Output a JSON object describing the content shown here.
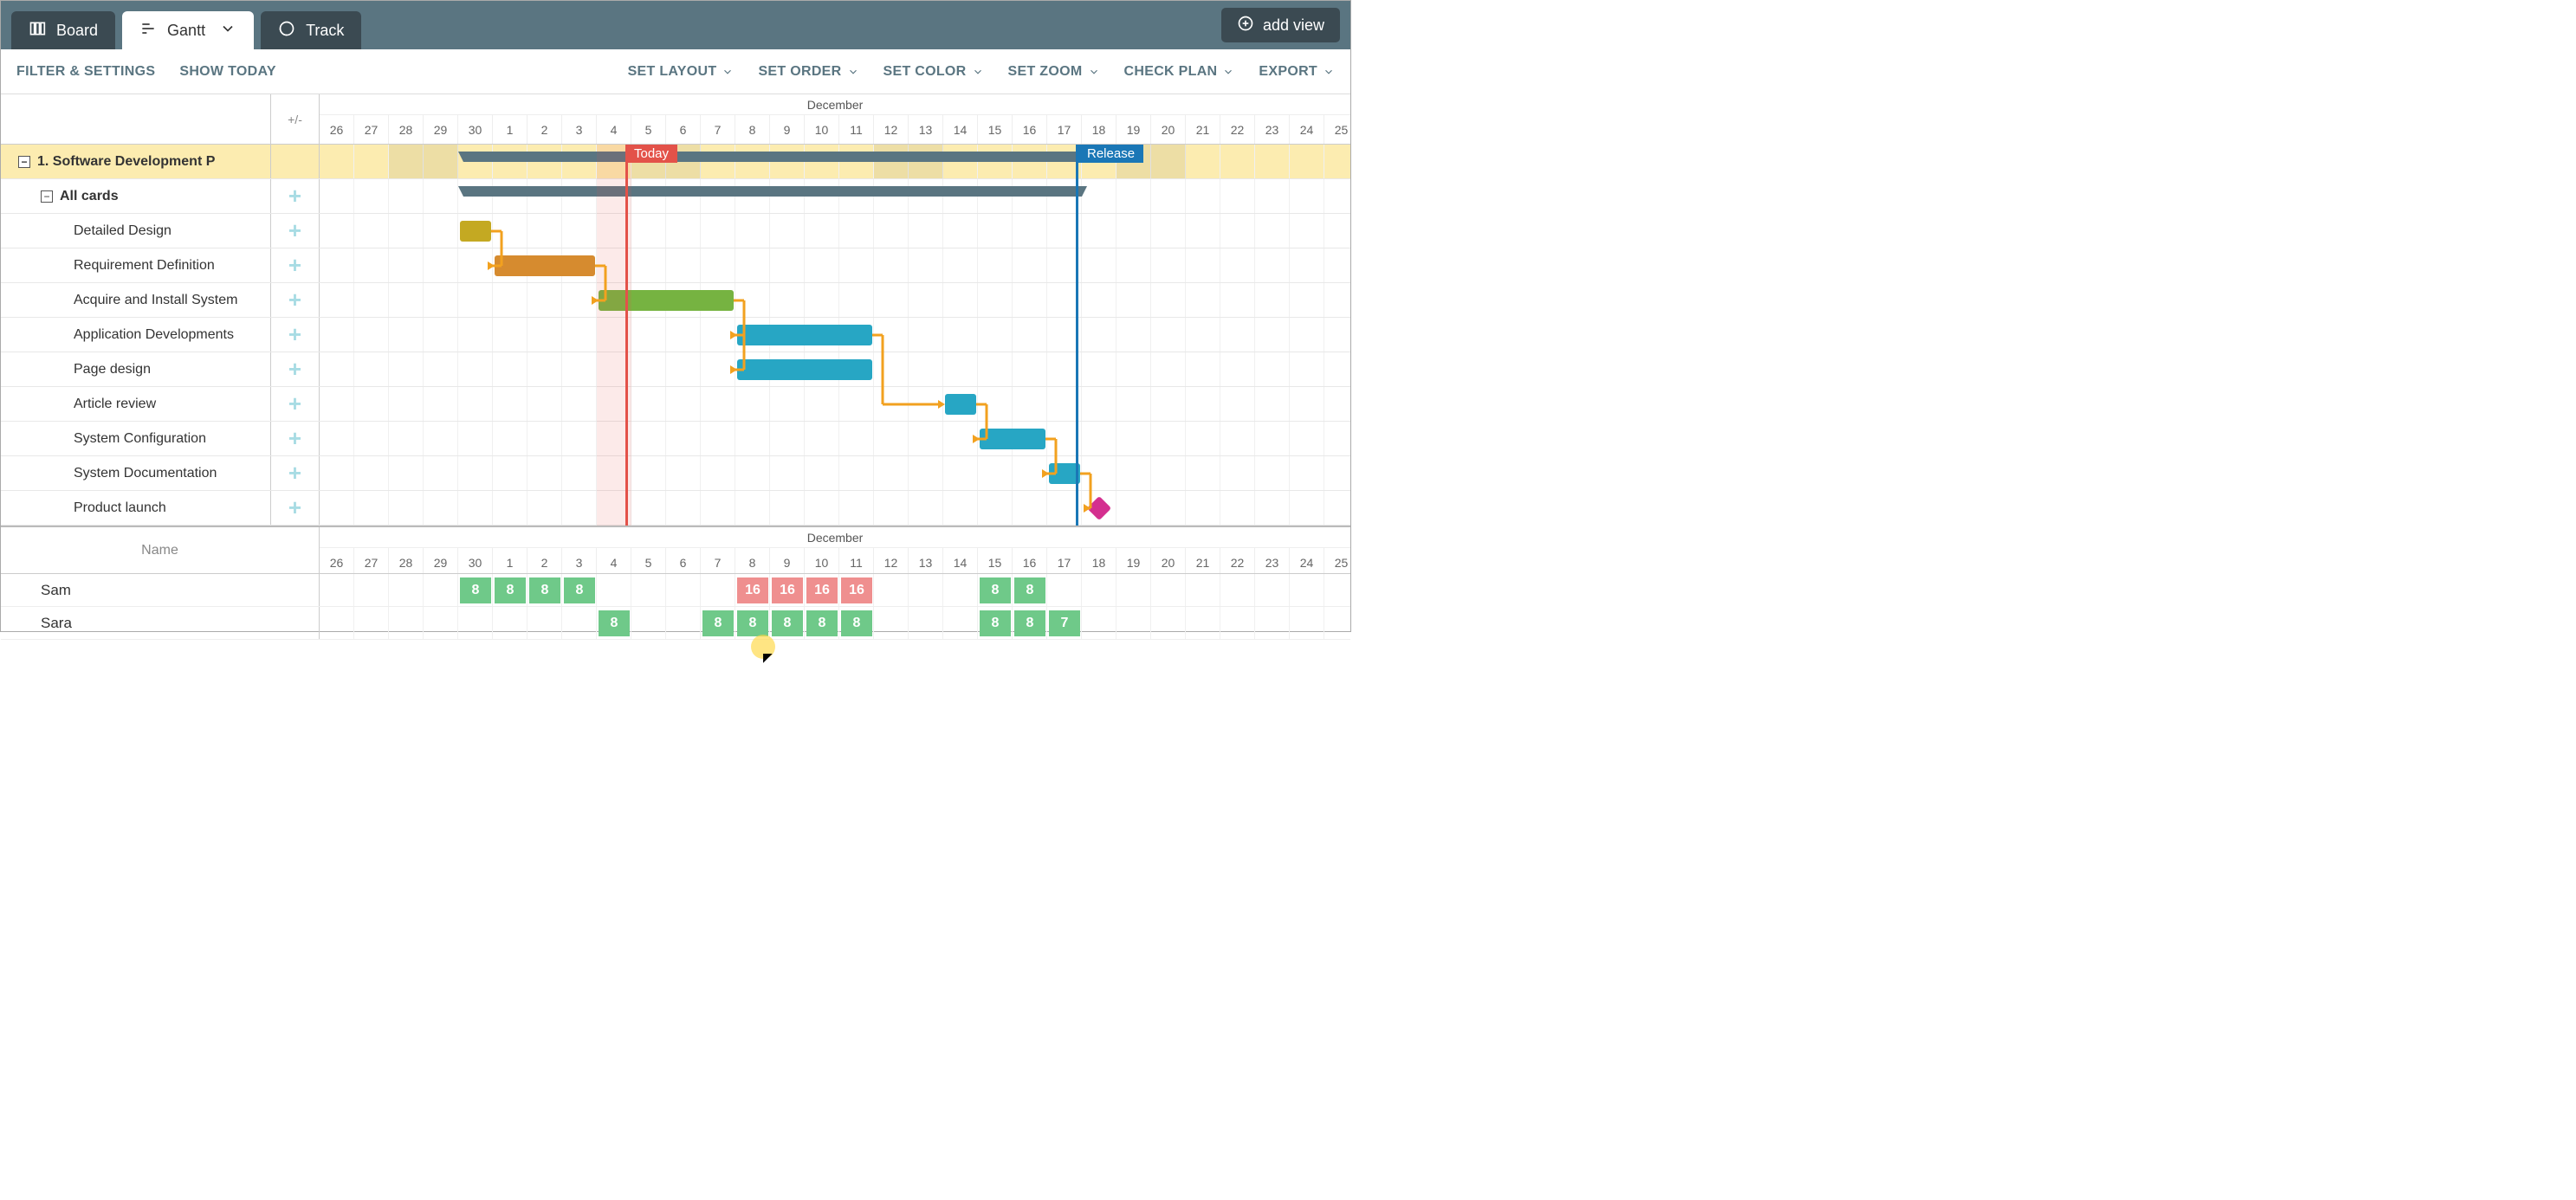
{
  "tabs": {
    "board": "Board",
    "gantt": "Gantt",
    "track": "Track"
  },
  "addView": "add view",
  "toolbar": {
    "filter": "FILTER & SETTINGS",
    "showToday": "SHOW TODAY",
    "setLayout": "SET LAYOUT",
    "setOrder": "SET ORDER",
    "setColor": "SET COLOR",
    "setZoom": "SET ZOOM",
    "checkPlan": "CHECK PLAN",
    "export": "EXPORT"
  },
  "plusMinus": "+/-",
  "month": "December",
  "days": [
    "26",
    "27",
    "28",
    "29",
    "30",
    "1",
    "2",
    "3",
    "4",
    "5",
    "6",
    "7",
    "8",
    "9",
    "10",
    "11",
    "12",
    "13",
    "14",
    "15",
    "16",
    "17",
    "18",
    "19",
    "20",
    "21",
    "22",
    "23",
    "24",
    "25"
  ],
  "markers": {
    "today": "Today",
    "release": "Release"
  },
  "rows": {
    "project": "1. Software Development P",
    "allCards": "All cards",
    "tasks": [
      "Detailed Design",
      "Requirement Definition",
      "Acquire and Install System",
      "Application Developments",
      "Page design",
      "Article review",
      "System Configuration",
      "System Documentation",
      "Product launch"
    ]
  },
  "resourceHeader": "Name",
  "resources": [
    {
      "name": "Sam",
      "allocs": [
        {
          "day": 4,
          "val": "8",
          "cls": "g8"
        },
        {
          "day": 5,
          "val": "8",
          "cls": "g8"
        },
        {
          "day": 6,
          "val": "8",
          "cls": "g8"
        },
        {
          "day": 7,
          "val": "8",
          "cls": "g8"
        },
        {
          "day": 12,
          "val": "16",
          "cls": "r16"
        },
        {
          "day": 13,
          "val": "16",
          "cls": "r16"
        },
        {
          "day": 14,
          "val": "16",
          "cls": "r16"
        },
        {
          "day": 15,
          "val": "16",
          "cls": "r16"
        },
        {
          "day": 19,
          "val": "8",
          "cls": "g8"
        },
        {
          "day": 20,
          "val": "8",
          "cls": "g8"
        }
      ]
    },
    {
      "name": "Sara",
      "allocs": [
        {
          "day": 8,
          "val": "8",
          "cls": "g8"
        },
        {
          "day": 11,
          "val": "8",
          "cls": "g8"
        },
        {
          "day": 12,
          "val": "8",
          "cls": "g8"
        },
        {
          "day": 13,
          "val": "8",
          "cls": "g8"
        },
        {
          "day": 14,
          "val": "8",
          "cls": "g8"
        },
        {
          "day": 15,
          "val": "8",
          "cls": "g8"
        },
        {
          "day": 19,
          "val": "8",
          "cls": "g8"
        },
        {
          "day": 20,
          "val": "8",
          "cls": "g8"
        },
        {
          "day": 21,
          "val": "7",
          "cls": "g7"
        }
      ]
    }
  ],
  "chart_data": {
    "type": "gantt",
    "month": "December",
    "start_date_axis": "Nov 26",
    "today": "Dec 4",
    "release": "Dec 17",
    "tasks": [
      {
        "name": "Software Development P",
        "type": "summary",
        "start": "Nov 30",
        "end": "Dec 18"
      },
      {
        "name": "All cards",
        "type": "summary",
        "start": "Nov 30",
        "end": "Dec 18"
      },
      {
        "name": "Detailed Design",
        "start": "Nov 30",
        "end": "Nov 30",
        "color": "#c4a922"
      },
      {
        "name": "Requirement Definition",
        "start": "Dec 1",
        "end": "Dec 3",
        "color": "#d68b2f"
      },
      {
        "name": "Acquire and Install System",
        "start": "Dec 4",
        "end": "Dec 7",
        "color": "#76b341",
        "progress_end": "Dec 5"
      },
      {
        "name": "Application Developments",
        "start": "Dec 8",
        "end": "Dec 11",
        "color": "#27a6c4"
      },
      {
        "name": "Page design",
        "start": "Dec 8",
        "end": "Dec 11",
        "color": "#27a6c4"
      },
      {
        "name": "Article review",
        "start": "Dec 14",
        "end": "Dec 14",
        "color": "#27a6c4"
      },
      {
        "name": "System Configuration",
        "start": "Dec 15",
        "end": "Dec 16",
        "color": "#27a6c4"
      },
      {
        "name": "System Documentation",
        "start": "Dec 17",
        "end": "Dec 17",
        "color": "#27a6c4"
      },
      {
        "name": "Product launch",
        "type": "milestone",
        "date": "Dec 18",
        "color": "#d42f8f"
      }
    ],
    "dependencies": [
      [
        "Detailed Design",
        "Requirement Definition"
      ],
      [
        "Requirement Definition",
        "Acquire and Install System"
      ],
      [
        "Acquire and Install System",
        "Application Developments"
      ],
      [
        "Acquire and Install System",
        "Page design"
      ],
      [
        "Application Developments",
        "Article review"
      ],
      [
        "Article review",
        "System Configuration"
      ],
      [
        "System Configuration",
        "System Documentation"
      ],
      [
        "System Documentation",
        "Product launch"
      ]
    ],
    "resources": [
      {
        "name": "Sam",
        "days": {
          "Nov 30": 8,
          "Dec 1": 8,
          "Dec 2": 8,
          "Dec 3": 8,
          "Dec 8": 16,
          "Dec 9": 16,
          "Dec 10": 16,
          "Dec 11": 16,
          "Dec 15": 8,
          "Dec 16": 8
        }
      },
      {
        "name": "Sara",
        "days": {
          "Dec 4": 8,
          "Dec 7": 8,
          "Dec 8": 8,
          "Dec 9": 8,
          "Dec 10": 8,
          "Dec 11": 8,
          "Dec 15": 8,
          "Dec 16": 8,
          "Dec 17": 7
        }
      }
    ]
  }
}
